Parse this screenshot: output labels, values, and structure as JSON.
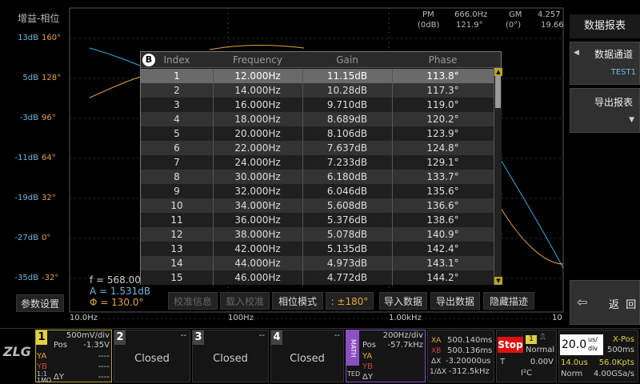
{
  "plot": {
    "title": "增益-相位",
    "db_ticks": [
      "13dB",
      "5dB",
      "-3dB",
      "-11dB",
      "-19dB",
      "-27dB",
      "-35dB"
    ],
    "phase_ticks": [
      "160°",
      "128°",
      "96°",
      "64°",
      "32°",
      "0°",
      "-32°"
    ],
    "freq_ticks": [
      "10.0Hz",
      "100Hz",
      "1.00kHz",
      "10"
    ],
    "measurements": {
      "pm_label": "PM",
      "pm_sub": "(0dB)",
      "pm_freq": "666.0Hz",
      "pm_val": "121.9°",
      "gm_label": "GM",
      "gm_sub": "(0°)",
      "gm_freq": "4.257",
      "gm_val": "19.66"
    },
    "cursor": {
      "f": "f = 568.00",
      "a": "A = 1.531dB",
      "phi": "Φ = 130.0°"
    },
    "colors": {
      "gain": "#3aa8d8",
      "phase": "#e8a33a",
      "grid": "#3a3a3a"
    }
  },
  "table": {
    "badge": "B",
    "headers": [
      "Index",
      "Frequency",
      "Gain",
      "Phase"
    ],
    "rows": [
      [
        "1",
        "12.000Hz",
        "11.15dB",
        "113.8°"
      ],
      [
        "2",
        "14.000Hz",
        "10.28dB",
        "117.3°"
      ],
      [
        "3",
        "16.000Hz",
        "9.710dB",
        "119.0°"
      ],
      [
        "4",
        "18.000Hz",
        "8.689dB",
        "120.2°"
      ],
      [
        "5",
        "20.000Hz",
        "8.106dB",
        "123.9°"
      ],
      [
        "6",
        "22.000Hz",
        "7.637dB",
        "124.8°"
      ],
      [
        "7",
        "24.000Hz",
        "7.233dB",
        "129.1°"
      ],
      [
        "8",
        "30.000Hz",
        "6.180dB",
        "133.7°"
      ],
      [
        "9",
        "32.000Hz",
        "6.046dB",
        "135.6°"
      ],
      [
        "10",
        "34.000Hz",
        "5.608dB",
        "136.6°"
      ],
      [
        "11",
        "36.000Hz",
        "5.376dB",
        "138.6°"
      ],
      [
        "12",
        "38.000Hz",
        "5.078dB",
        "140.9°"
      ],
      [
        "13",
        "42.000Hz",
        "5.135dB",
        "142.4°"
      ],
      [
        "14",
        "44.000Hz",
        "4.973dB",
        "143.1°"
      ],
      [
        "15",
        "46.000Hz",
        "4.772dB",
        "144.2°"
      ]
    ]
  },
  "buttons": {
    "params": "参数设置",
    "calib_info": "校准信息",
    "load_calib": "载入校准",
    "phase_mode": "相位模式",
    "phase_range": ": ±180°",
    "import": "导入数据",
    "export": "导出数据",
    "hide_trace": "隐藏描迹"
  },
  "right_panel": {
    "title": "数据报表",
    "channel_label": "数据通道",
    "channel_value": "TEST1",
    "export_report": "导出报表",
    "back": "返  回"
  },
  "status": {
    "ch1": {
      "num": "1",
      "scale": "500mV/div",
      "pos_label": "Pos",
      "pos": "-1.35V",
      "ya": "YA",
      "yb": "YB",
      "dy": "ΔY",
      "dash": "----",
      "coupling": "1:1",
      "bw": "1MΩ"
    },
    "ch2": {
      "num": "2",
      "status": "Closed",
      "dash": "--"
    },
    "ch3": {
      "num": "3",
      "status": "Closed",
      "dash": "--"
    },
    "ch4": {
      "num": "4",
      "status": "Closed",
      "dash": "--"
    },
    "math": {
      "label": "MATH",
      "scale": "200Hz/div",
      "pos_label": "Pos",
      "pos": "-57.7kHz",
      "ya": "YA",
      "yb": "YB",
      "dy": "ΔY",
      "ted": "TED",
      "dash": "----"
    },
    "cursor_xa": {
      "label": "XA",
      "val": "500.140ms"
    },
    "cursor_xb": {
      "label": "XB",
      "val": "500.136ms"
    },
    "cursor_dx": {
      "label": "ΔX",
      "val": "-3.20000us"
    },
    "cursor_inv": {
      "label": "1/ΔX",
      "val": "-312.5kHz"
    },
    "run_state": "Stop",
    "trig_mode": "Normal",
    "trig_ch": "1",
    "trig_t": "T",
    "trig_level": "0.00V",
    "trig_proto": "I²C",
    "timebase": "20.0",
    "timebase_unit_top": "us/",
    "timebase_unit_bot": "div",
    "xpos_label": "X-Pos",
    "xpos": "500ms",
    "delay": "14.0us",
    "mem": "56.0Kpts",
    "acq": "Norm",
    "rate": "4.00GSa/s"
  }
}
